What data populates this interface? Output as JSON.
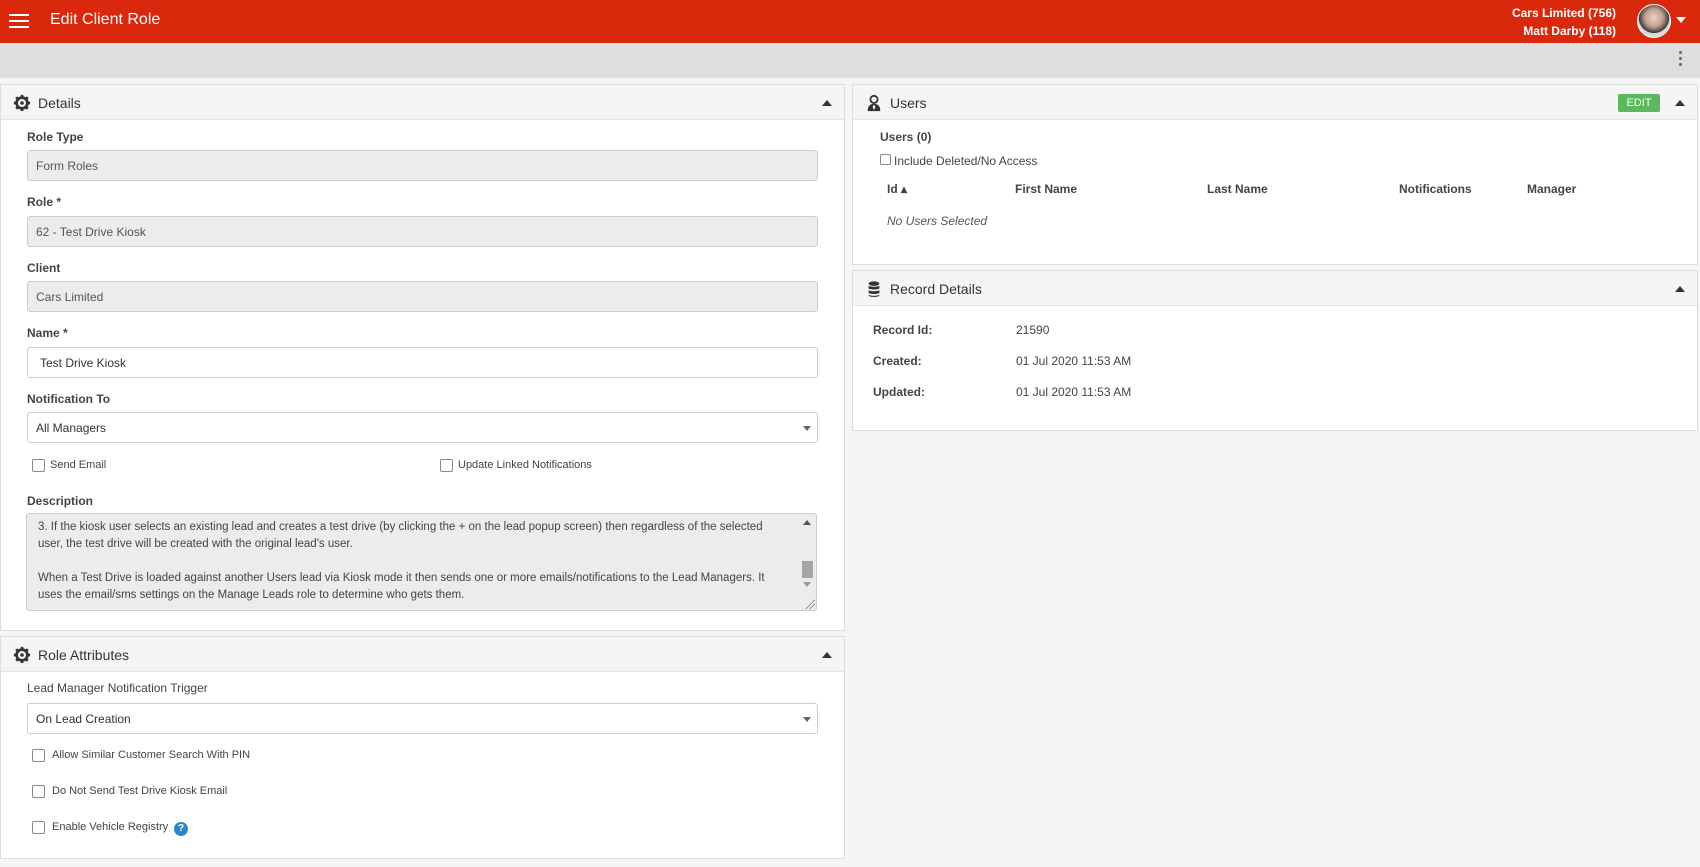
{
  "header": {
    "title": "Edit Client Role",
    "client_line1": "Cars Limited (756)",
    "client_line2": "Matt Darby (118)",
    "menu_icon": "hamburger-icon",
    "avatar_icon": "user-avatar",
    "brand_color": "#d9280c"
  },
  "details": {
    "title": "Details",
    "icon": "gear-icon",
    "role_type_label": "Role Type",
    "role_type_value": "Form Roles",
    "role_label": "Role *",
    "role_value": "62 - Test Drive Kiosk",
    "client_label": "Client",
    "client_value": "Cars Limited",
    "name_label": "Name *",
    "name_value": "Test Drive Kiosk",
    "notification_label": "Notification To",
    "notification_value": "All Managers",
    "send_email_label": "Send Email",
    "send_email_checked": false,
    "update_linked_label": "Update Linked Notifications",
    "update_linked_checked": false,
    "description_label": "Description",
    "description_p1": "3.      If the kiosk user selects an existing lead and creates a test drive (by clicking the + on the lead popup screen) then regardless of the selected user, the test drive will be created with the original lead's user.",
    "description_p2": "When a Test Drive is loaded against another Users lead via Kiosk mode it then sends one or more emails/notifications to the Lead Managers.  It uses the email/sms settings on the Manage Leads role to determine who gets them."
  },
  "role_attributes": {
    "title": "Role Attributes",
    "icon": "gear-icon",
    "trigger_label": "Lead Manager Notification Trigger",
    "trigger_value": "On Lead Creation",
    "similar_search_label": "Allow Similar Customer Search With PIN",
    "no_email_label": "Do Not Send Test Drive Kiosk Email",
    "vehicle_registry_label": "Enable Vehicle Registry",
    "help_glyph": "?"
  },
  "users": {
    "title": "Users",
    "icon": "user-tie-icon",
    "edit_label": "EDIT",
    "edit_color": "#5cb85c",
    "count_label": "Users (0)",
    "include_deleted_label": "Include Deleted/No Access",
    "columns": [
      "Id ▴",
      "First Name",
      "Last Name",
      "Notifications",
      "Manager"
    ],
    "empty_text": "No Users Selected"
  },
  "record_details": {
    "title": "Record Details",
    "icon": "database-icon",
    "rows": [
      {
        "label": "Record Id:",
        "value": "21590"
      },
      {
        "label": "Created:",
        "value": "01 Jul 2020 11:53 AM"
      },
      {
        "label": "Updated:",
        "value": "01 Jul 2020 11:53 AM"
      }
    ]
  }
}
